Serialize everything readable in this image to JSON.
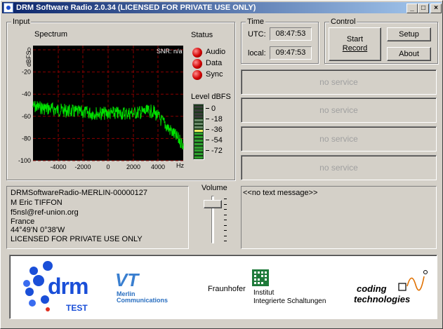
{
  "window": {
    "title": "DRM Software Radio 2.0.34 (LICENSED FOR PRIVATE USE ONLY)",
    "controls": [
      "_",
      "□",
      "×"
    ]
  },
  "input": {
    "group_label": "Input",
    "spectrum_label": "Spectrum",
    "snr_text": "SNR: n/a",
    "y_axis_unit": "dBFS",
    "y_ticks": [
      "0",
      "-20",
      "-40",
      "-60",
      "-80",
      "-100"
    ],
    "x_ticks": [
      "-4000",
      "-2000",
      "0",
      "2000",
      "4000"
    ],
    "x_unit": "Hz",
    "status_label": "Status",
    "status_items": [
      "Audio",
      "Data",
      "Sync"
    ],
    "status_color": "#d00000",
    "level_label": "Level dBFS",
    "level_ticks": [
      "0",
      "-18",
      "-36",
      "-54",
      "-72"
    ],
    "spectrum_color": "#00e000"
  },
  "time": {
    "group_label": "Time",
    "utc_label": "UTC:",
    "utc_value": "08:47:53",
    "local_label": "local:",
    "local_value": "09:47:53"
  },
  "control": {
    "group_label": "Control",
    "start_record_line1": "Start",
    "start_record_line2": "Record",
    "setup": "Setup",
    "about": "About"
  },
  "services": [
    "no service",
    "no service",
    "no service",
    "no service"
  ],
  "station_info": {
    "lines": [
      "DRMSoftwareRadio-MERLIN-00000127",
      "M Eric TIFFON",
      "f5nsl@ref-union.org",
      "France",
      "44°49'N    0°38'W",
      "LICENSED FOR PRIVATE USE ONLY"
    ]
  },
  "volume": {
    "label": "Volume",
    "level_fraction": 0.9
  },
  "text_message": "<<no text message>>",
  "logos": {
    "drm_word": "drm",
    "drm_sub": "TEST",
    "vt_mark": "VT",
    "vt_line1": "Merlin",
    "vt_line2": "Communications",
    "fraunhofer": "Fraunhofer",
    "iis_mark": "IIS",
    "iis_line1": "Institut",
    "iis_line2": "Integrierte Schaltungen",
    "ct_line1": "coding",
    "ct_line2": "technologies"
  }
}
